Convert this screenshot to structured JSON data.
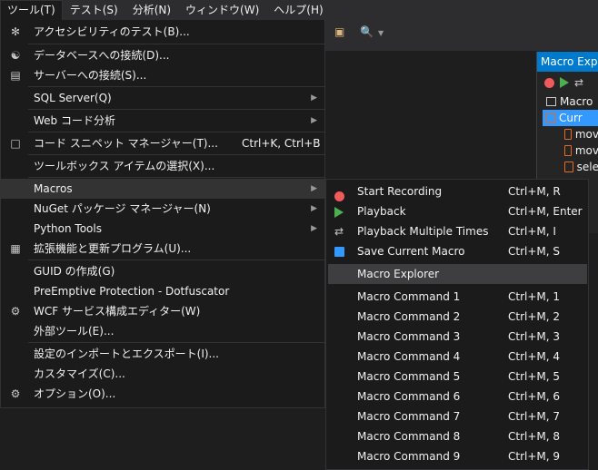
{
  "menubar": {
    "items": [
      "ツール(T)",
      "テスト(S)",
      "分析(N)",
      "ウィンドウ(W)",
      "ヘルプ(H)"
    ]
  },
  "macro_explorer": {
    "title": "Macro Explorer",
    "root": "Macro",
    "items": [
      "Curr",
      "mov",
      "mov",
      "sele"
    ]
  },
  "tools_menu": {
    "items": [
      {
        "label": "アクセシビリティのテスト(B)...",
        "shortcut": "",
        "icon": "accessibility-icon"
      },
      {
        "label": "データベースへの接続(D)...",
        "shortcut": "",
        "icon": "database-connect-icon"
      },
      {
        "label": "サーバーへの接続(S)...",
        "shortcut": "",
        "icon": "server-connect-icon"
      },
      {
        "label": "SQL Server(Q)",
        "shortcut": "",
        "icon": ""
      },
      {
        "label": "Web コード分析",
        "shortcut": "",
        "icon": ""
      },
      {
        "label": "コード スニペット マネージャー(T)...",
        "shortcut": "Ctrl+K, Ctrl+B",
        "icon": "snippet-icon"
      },
      {
        "label": "ツールボックス アイテムの選択(X)...",
        "shortcut": "",
        "icon": ""
      },
      {
        "label": "Macros",
        "shortcut": "",
        "icon": ""
      },
      {
        "label": "NuGet パッケージ マネージャー(N)",
        "shortcut": "",
        "icon": ""
      },
      {
        "label": "Python Tools",
        "shortcut": "",
        "icon": ""
      },
      {
        "label": "拡張機能と更新プログラム(U)...",
        "shortcut": "",
        "icon": "extensions-icon"
      },
      {
        "label": "GUID の作成(G)",
        "shortcut": "",
        "icon": ""
      },
      {
        "label": "PreEmptive Protection - Dotfuscator",
        "shortcut": "",
        "icon": ""
      },
      {
        "label": "WCF サービス構成エディター(W)",
        "shortcut": "",
        "icon": "wcf-gear-icon"
      },
      {
        "label": "外部ツール(E)...",
        "shortcut": "",
        "icon": ""
      },
      {
        "label": "設定のインポートとエクスポート(I)...",
        "shortcut": "",
        "icon": ""
      },
      {
        "label": "カスタマイズ(C)...",
        "shortcut": "",
        "icon": ""
      },
      {
        "label": "オプション(O)...",
        "shortcut": "",
        "icon": "options-gear-icon"
      }
    ]
  },
  "macros_submenu": {
    "items": [
      {
        "label": "Start Recording",
        "shortcut": "Ctrl+M, R"
      },
      {
        "label": "Playback",
        "shortcut": "Ctrl+M, Enter"
      },
      {
        "label": "Playback Multiple Times",
        "shortcut": "Ctrl+M, I"
      },
      {
        "label": "Save Current Macro",
        "shortcut": "Ctrl+M, S"
      },
      {
        "label": "Macro Explorer",
        "shortcut": ""
      },
      {
        "label": "Macro Command 1",
        "shortcut": "Ctrl+M, 1"
      },
      {
        "label": "Macro Command 2",
        "shortcut": "Ctrl+M, 2"
      },
      {
        "label": "Macro Command 3",
        "shortcut": "Ctrl+M, 3"
      },
      {
        "label": "Macro Command 4",
        "shortcut": "Ctrl+M, 4"
      },
      {
        "label": "Macro Command 5",
        "shortcut": "Ctrl+M, 5"
      },
      {
        "label": "Macro Command 6",
        "shortcut": "Ctrl+M, 6"
      },
      {
        "label": "Macro Command 7",
        "shortcut": "Ctrl+M, 7"
      },
      {
        "label": "Macro Command 8",
        "shortcut": "Ctrl+M, 8"
      },
      {
        "label": "Macro Command 9",
        "shortcut": "Ctrl+M, 9"
      }
    ]
  },
  "colors": {
    "accent": "#007acc",
    "selection": "#3399ff",
    "record": "#f05a5a",
    "play": "#4caf50"
  }
}
